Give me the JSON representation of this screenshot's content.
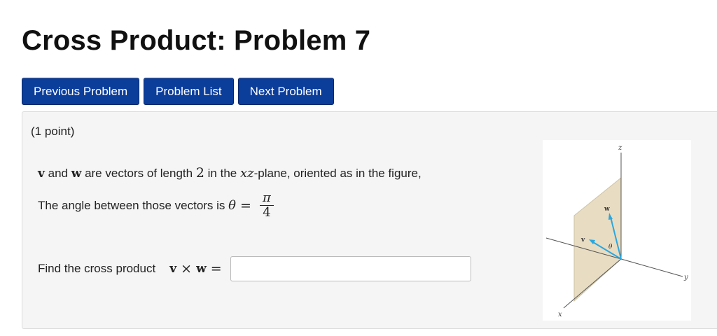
{
  "page": {
    "title": "Cross Product: Problem 7"
  },
  "nav": {
    "previous_label": "Previous Problem",
    "list_label": "Problem List",
    "next_label": "Next Problem"
  },
  "problem": {
    "points": "(1 point)",
    "v": "v",
    "and_text": " and ",
    "w": "w",
    "sentence1_mid": " are vectors of length ",
    "length": "2",
    "in_the": " in the ",
    "plane_var": "xz",
    "sentence1_end": "-plane, oriented as in the figure,",
    "angle_text": "The angle between those vectors is ",
    "theta": "θ",
    "equals": " = ",
    "angle_num": "π",
    "angle_den": "4",
    "find_text": "Find the cross product",
    "cross_v": "v",
    "cross_times": " × ",
    "cross_w": "w",
    "cross_equals": " =",
    "answer_value": ""
  },
  "figure": {
    "label_z": "z",
    "label_y": "y",
    "label_x": "x",
    "label_v": "v",
    "label_w": "w",
    "label_theta": "θ",
    "plane_color": "#e8dcc2",
    "vector_color": "#2aa7df"
  }
}
